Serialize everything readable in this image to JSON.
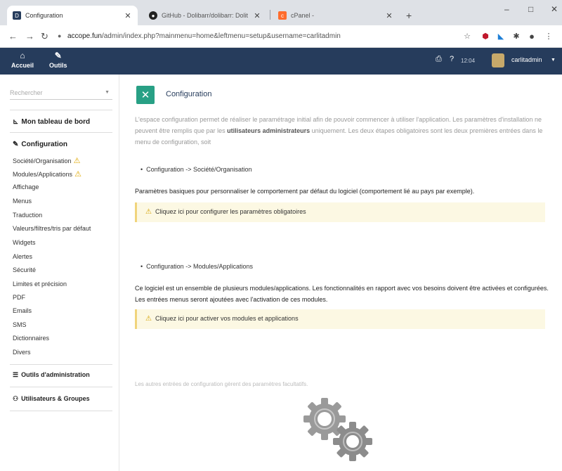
{
  "browser": {
    "tabs": [
      {
        "title": "Configuration",
        "active": true
      },
      {
        "title": "GitHub - Dolibarr/dolibarr: Dolit"
      },
      {
        "title": "cPanel -"
      }
    ],
    "url_domain": "accope.fun",
    "url_path": "/admin/index.php?mainmenu=home&leftmenu=setup&username=carlitadmin",
    "window_controls": [
      "–",
      "□",
      "✕"
    ]
  },
  "topbar": {
    "menus": [
      {
        "label": "Accueil",
        "icon": "home-icon"
      },
      {
        "label": "Outils",
        "icon": "wrench-icon"
      }
    ],
    "time": "12:04",
    "user": "carlitadmin"
  },
  "sidebar": {
    "search_placeholder": "Rechercher",
    "dashboard": "Mon tableau de bord",
    "config_head": "Configuration",
    "items": [
      {
        "label": "Société/Organisation",
        "warn": true
      },
      {
        "label": "Modules/Applications",
        "warn": true
      },
      {
        "label": "Affichage"
      },
      {
        "label": "Menus"
      },
      {
        "label": "Traduction"
      },
      {
        "label": "Valeurs/filtres/tris par défaut"
      },
      {
        "label": "Widgets"
      },
      {
        "label": "Alertes"
      },
      {
        "label": "Sécurité"
      },
      {
        "label": "Limites et précision"
      },
      {
        "label": "PDF"
      },
      {
        "label": "Emails"
      },
      {
        "label": "SMS"
      },
      {
        "label": "Dictionnaires"
      },
      {
        "label": "Divers"
      }
    ],
    "admin_tools": "Outils d'administration",
    "users_groups": "Utilisateurs & Groupes"
  },
  "main": {
    "title": "Configuration",
    "intro_part1": "L'espace configuration permet de réaliser le paramétrage initial afin de pouvoir commencer à utiliser l'application. Les paramètres d'installation ne peuvent être remplis que par les ",
    "intro_bold": "utilisateurs administrateurs",
    "intro_part2": " uniquement. Les deux étapes obligatoires sont les deux premières entrées dans le menu de configuration, soit",
    "section1_title": "Configuration -> Société/Organisation",
    "section1_desc": "Paramètres basiques pour personnaliser le comportement par défaut du logiciel (comportement lié au pays par exemple).",
    "section1_alert": "Cliquez ici pour configurer les paramètres obligatoires",
    "section2_title": "Configuration -> Modules/Applications",
    "section2_desc": "Ce logiciel est un ensemble de plusieurs modules/applications. Les fonctionnalités en rapport avec vos besoins doivent être activées et configurées. Les entrées menus seront ajoutées avec l'activation de ces modules.",
    "section2_alert": "Cliquez ici pour activer vos modules et applications",
    "footer_note": "Les autres entrées de configuration gèrent des paramètres facultatifs."
  },
  "colors": {
    "topbar": "#263c5c",
    "accent_green": "#28a085",
    "alert_bg": "#fcf8e3",
    "warning": "#e0a800"
  }
}
